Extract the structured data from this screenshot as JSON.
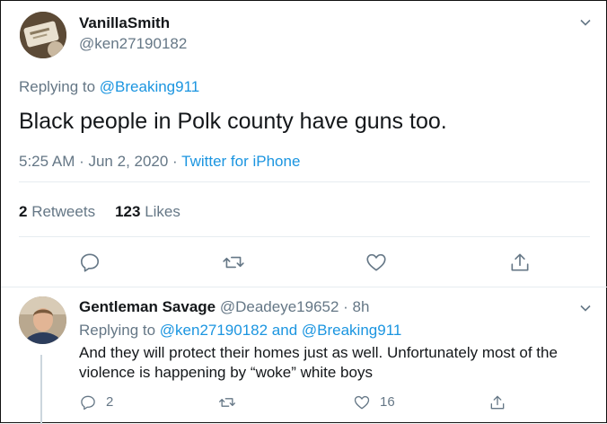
{
  "main_tweet": {
    "display_name": "VanillaSmith",
    "handle": "@ken27190182",
    "replying_prefix": "Replying to ",
    "replying_to": "@Breaking911",
    "text": "Black people in Polk county have guns too.",
    "timestamp": "5:25 AM · Jun 2, 2020 · ",
    "source": "Twitter for iPhone",
    "retweets_count": "2",
    "retweets_label": "Retweets",
    "likes_count": "123",
    "likes_label": "Likes"
  },
  "reply_tweet": {
    "display_name": "Gentleman Savage",
    "handle_time": "@Deadeye19652 · 8h",
    "replying_prefix": "Replying to ",
    "replying_to": "@ken27190182 and @Breaking911",
    "text": "And they will protect their homes just as well. Unfortunately most of the violence is happening by “woke” white boys",
    "reply_count": "2",
    "like_count": "16"
  },
  "icons": {
    "reply": "reply-icon",
    "retweet": "retweet-icon",
    "like": "heart-icon",
    "share": "share-icon",
    "more": "chevron-down-icon"
  },
  "colors": {
    "link": "#1b95e0",
    "muted": "#657786",
    "text": "#14171a",
    "divider": "#e6ecf0"
  }
}
